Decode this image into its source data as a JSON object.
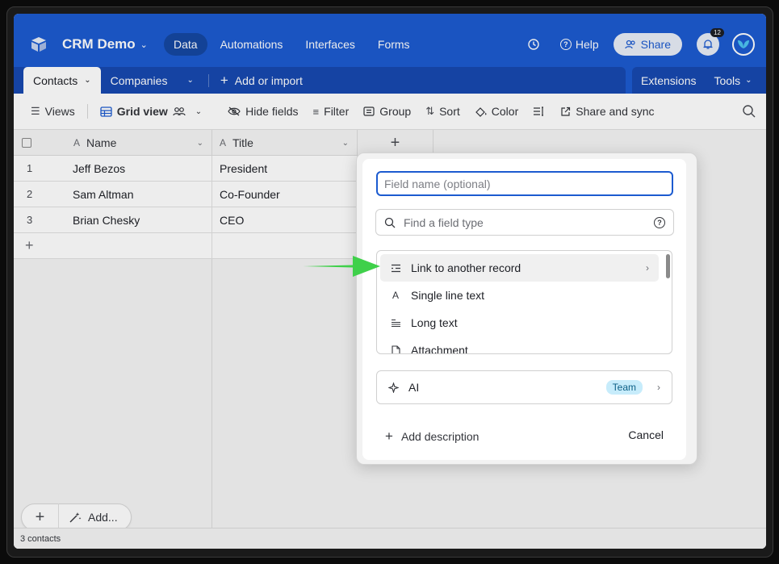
{
  "topbar": {
    "base_name": "CRM Demo",
    "nav": [
      "Data",
      "Automations",
      "Interfaces",
      "Forms"
    ],
    "active_nav": "Data",
    "help_label": "Help",
    "share_label": "Share",
    "notification_count": "12"
  },
  "tabs": {
    "items": [
      "Contacts",
      "Companies"
    ],
    "active": "Contacts",
    "add_import_label": "Add or import",
    "extensions_label": "Extensions",
    "tools_label": "Tools"
  },
  "viewbar": {
    "views_label": "Views",
    "view_name": "Grid view",
    "hide_fields": "Hide fields",
    "filter": "Filter",
    "group": "Group",
    "sort": "Sort",
    "color": "Color",
    "share_sync": "Share and sync"
  },
  "grid": {
    "columns": [
      "Name",
      "Title"
    ],
    "rows": [
      {
        "num": "1",
        "name": "Jeff Bezos",
        "title": "President"
      },
      {
        "num": "2",
        "name": "Sam Altman",
        "title": "Co-Founder"
      },
      {
        "num": "3",
        "name": "Brian Chesky",
        "title": "CEO"
      }
    ],
    "record_count": "3 contacts",
    "add_more_label": "Add..."
  },
  "dialog": {
    "field_name_placeholder": "Field name (optional)",
    "search_placeholder": "Find a field type",
    "types": [
      "Link to another record",
      "Single line text",
      "Long text",
      "Attachment"
    ],
    "ai_label": "AI",
    "ai_badge": "Team",
    "add_description": "Add description",
    "cancel": "Cancel"
  },
  "colors": {
    "brand": "#1c5bd0",
    "arrow": "#3fd04a",
    "badge_bg": "#c7ecfb"
  }
}
